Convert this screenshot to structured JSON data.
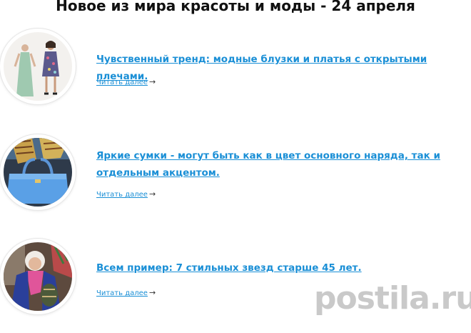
{
  "page": {
    "title": "Новое из мира красоты и моды - 24 апреля"
  },
  "articles": [
    {
      "title": "Чувственный тренд: модные блузки и платья с открытыми плечами.",
      "more": "Читать далее",
      "thumb_icon": "fashion-dresses-photo"
    },
    {
      "title": "Яркие сумки - могут быть как в цвет основного наряда, так и отдельным акцентом.",
      "more": "Читать далее",
      "thumb_icon": "blue-handbag-photo"
    },
    {
      "title": "Всем пример: 7 стильных звезд старше 45 лет.",
      "more": "Читать далее",
      "thumb_icon": "stylish-woman-photo"
    }
  ],
  "arrow_glyph": "→",
  "watermark": "postila.ru",
  "colors": {
    "link": "#1a8fd6",
    "title": "#111111",
    "watermark": "#c9c9c9"
  }
}
